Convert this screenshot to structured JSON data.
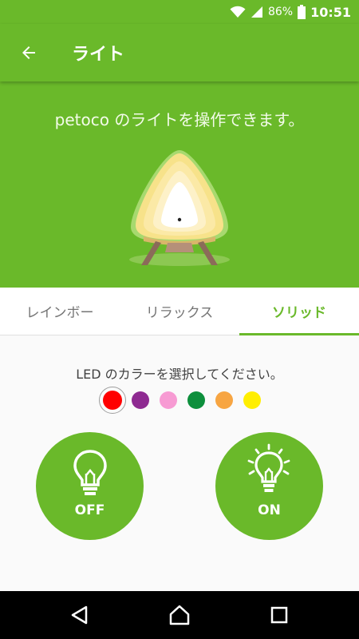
{
  "status_bar": {
    "battery": "86%",
    "time": "10:51",
    "icons": [
      "wifi-icon",
      "signal-icon",
      "battery-icon"
    ]
  },
  "app_bar": {
    "title": "ライト",
    "back_icon": "arrow-left-icon"
  },
  "hero": {
    "description": "petoco のライトを操作できます。"
  },
  "tabs": [
    {
      "label": "レインボー",
      "active": false
    },
    {
      "label": "リラックス",
      "active": false
    },
    {
      "label": "ソリッド",
      "active": true
    }
  ],
  "led": {
    "prompt": "LED のカラーを選択してください。",
    "colors": [
      "#ff0000",
      "#8e2a91",
      "#f79bd3",
      "#0d8f3c",
      "#f7a542",
      "#ffee00"
    ],
    "selected_index": 0
  },
  "power": {
    "off_label": "OFF",
    "on_label": "ON"
  },
  "theme": {
    "primary": "#6ab92a"
  }
}
